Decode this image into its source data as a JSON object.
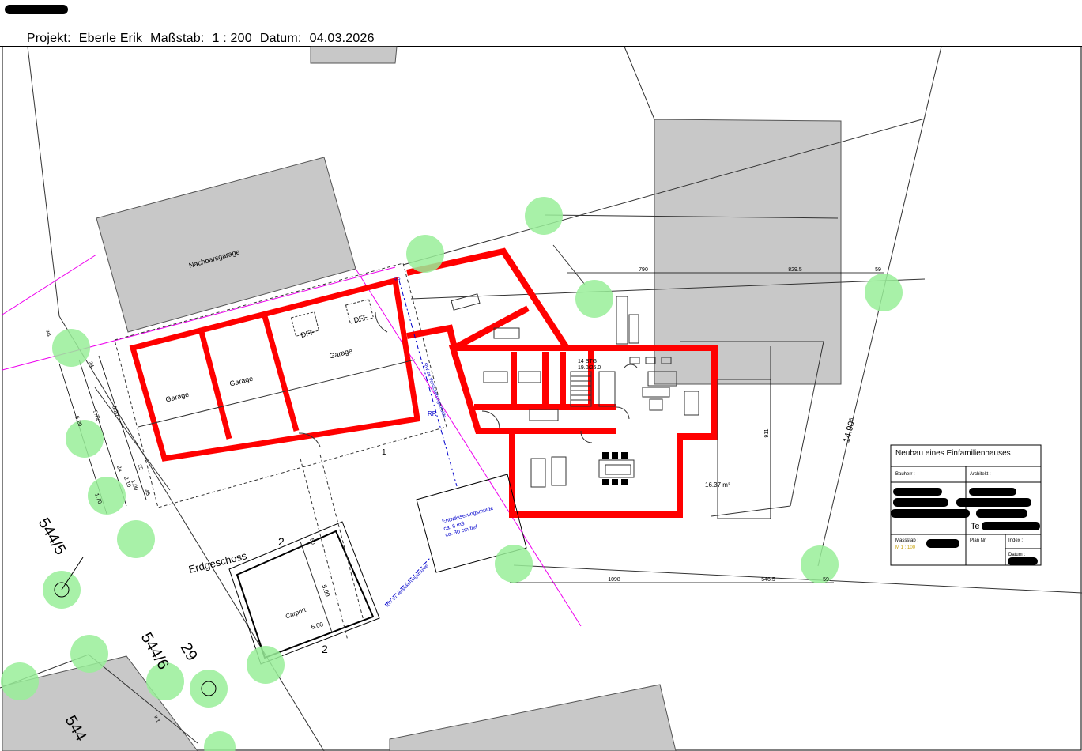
{
  "header": {
    "projekt_label": "Projekt:",
    "projekt_value": "Eberle Erik",
    "massstab_label": "Maßstab:",
    "massstab_value": "1 : 200",
    "datum_label": "Datum:",
    "datum_value": "04.03.2026"
  },
  "plan": {
    "neighbour_garage": "Nachbarsgarage",
    "garage_1": "Garage",
    "garage_2": "Garage",
    "garage_3": "Garage",
    "dff_1": "DFF",
    "dff_2": "DFF",
    "floor_label": "Erdgeschoss",
    "carport": "Carport",
    "carport_dim_a": "5.00",
    "carport_dim_b": "6.00",
    "carport_mark_a": "2",
    "carport_mark_b": "2",
    "carport_mark_c": "50",
    "stairs": "14 STG",
    "stairs_ratio": "19.0/26.0",
    "terrace_area": "16.37 m²",
    "swale_title": "Entwässerungsmulde",
    "swale_line1": "ca. 6 m3",
    "swale_line2": "ca. 30 cm tief",
    "rr_label": "RR",
    "rr_label_2": "RR",
    "swale_pipe": "RW zu Versickerungsmulde",
    "rw_pipe": "RW zu Versickerungsmulde",
    "parcel_1": "544/5",
    "parcel_2": "544/6",
    "parcel_3": "29",
    "parcel_4": "544",
    "w1_a": "w1",
    "w1_b": "w1",
    "marker_1": "1"
  },
  "dimensions": {
    "top_a": "790",
    "top_b": "829.5",
    "top_c": "59",
    "bottom_a": "1098",
    "bottom_b": "546.5",
    "bottom_c": "59",
    "right_vertical": "911",
    "diagonal": "14.90⁵",
    "left_a": "24",
    "left_b": "5.72",
    "left_c": "6.20",
    "left_d": "6.20",
    "left_e": "24",
    "left_f": "1.00",
    "left_g": "2.10",
    "left_h": "1.70",
    "left_i": "25",
    "left_j": "45"
  },
  "title_block": {
    "title": "Neubau eines Einfamilienhauses",
    "bauherr": "Bauherr :",
    "architekt": "Architekt :",
    "te": "Te",
    "massstab": "Massstab :",
    "massstab_value": "M 1 : 100",
    "plan_nr": "Plan Nr.",
    "index": "Index :",
    "datum": "Datum :"
  },
  "colors": {
    "wall": "#ff0000",
    "building_fill": "#c8c8c8",
    "tree": "#99ee99",
    "pipe": "#0000cc",
    "boundary": "#ee00ee",
    "accent_text": "#c8a000"
  }
}
